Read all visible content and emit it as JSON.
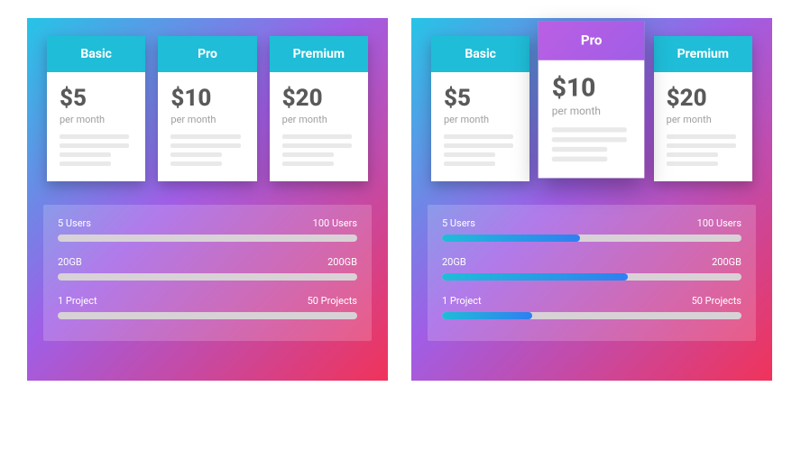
{
  "plans": [
    {
      "name": "Basic",
      "price": "$5",
      "per": "per month"
    },
    {
      "name": "Pro",
      "price": "$10",
      "per": "per month"
    },
    {
      "name": "Premium",
      "price": "$20",
      "per": "per month"
    }
  ],
  "sliders": [
    {
      "min_label": "5 Users",
      "max_label": "100 Users"
    },
    {
      "min_label": "20GB",
      "max_label": "200GB"
    },
    {
      "min_label": "1 Project",
      "max_label": "50 Projects"
    }
  ],
  "panel_left": {
    "active_plan_index": null,
    "fills_pct": [
      0,
      0,
      0
    ]
  },
  "panel_right": {
    "active_plan_index": 1,
    "fills_pct": [
      46,
      62,
      30
    ]
  }
}
